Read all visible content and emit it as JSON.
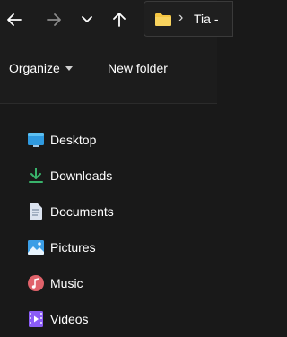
{
  "navigation": {
    "back_icon": "arrow-left-icon",
    "forward_icon": "arrow-right-icon",
    "recent_icon": "chevron-down-icon",
    "up_icon": "arrow-up-icon"
  },
  "address_bar": {
    "folder_icon": "folder-icon",
    "separator": "›",
    "current": "Tia -"
  },
  "toolbar": {
    "organize_label": "Organize",
    "new_folder_label": "New folder"
  },
  "nav_pane": {
    "items": [
      {
        "label": "Desktop",
        "icon": "desktop-icon"
      },
      {
        "label": "Downloads",
        "icon": "download-icon"
      },
      {
        "label": "Documents",
        "icon": "document-icon"
      },
      {
        "label": "Pictures",
        "icon": "pictures-icon"
      },
      {
        "label": "Music",
        "icon": "music-icon"
      },
      {
        "label": "Videos",
        "icon": "videos-icon"
      }
    ]
  },
  "colors": {
    "background": "#191919",
    "bar": "#1c1c1c",
    "folder": "#f4c542",
    "downloads": "#39b36b",
    "music": "#e0626a",
    "videos": "#8b5cf6",
    "desktop": "#2f9ae0"
  }
}
